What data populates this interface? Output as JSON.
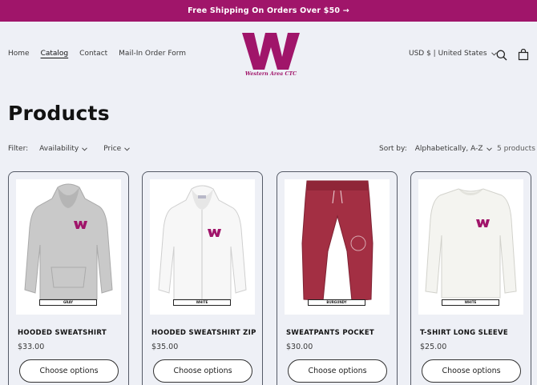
{
  "announcement": "Free Shipping On Orders Over $50 →",
  "nav": {
    "items": [
      "Home",
      "Catalog",
      "Contact",
      "Mail-In Order Form"
    ],
    "active": "Catalog"
  },
  "logo": {
    "mark": "W",
    "subtitle": "Western Area CTC"
  },
  "locale": "USD $ | United States",
  "page_title": "Products",
  "filter": {
    "label": "Filter:",
    "availability": "Availability",
    "price": "Price"
  },
  "sort": {
    "label": "Sort by:",
    "value": "Alphabetically, A-Z"
  },
  "product_count": "5 products",
  "products": [
    {
      "name": "HOODED SWEATSHIRT",
      "price": "$33.00",
      "button": "Choose options",
      "color_tag": "GRAY",
      "garment": "hoodie",
      "garment_color": "#c9c9c9"
    },
    {
      "name": "HOODED SWEATSHIRT ZIP",
      "price": "$35.00",
      "button": "Choose options",
      "color_tag": "WHITE",
      "garment": "zip-hoodie",
      "garment_color": "#f7f7f7"
    },
    {
      "name": "SWEATPANTS POCKET",
      "price": "$30.00",
      "button": "Choose options",
      "color_tag": "BURGUNDY",
      "garment": "sweatpants",
      "garment_color": "#a32f43"
    },
    {
      "name": "T-SHIRT LONG SLEEVE",
      "price": "$25.00",
      "button": "Choose options",
      "color_tag": "WHITE",
      "garment": "long-sleeve",
      "garment_color": "#f4f4f0"
    }
  ],
  "colors": {
    "brand": "#a0156a",
    "background": "#eef0f6"
  }
}
